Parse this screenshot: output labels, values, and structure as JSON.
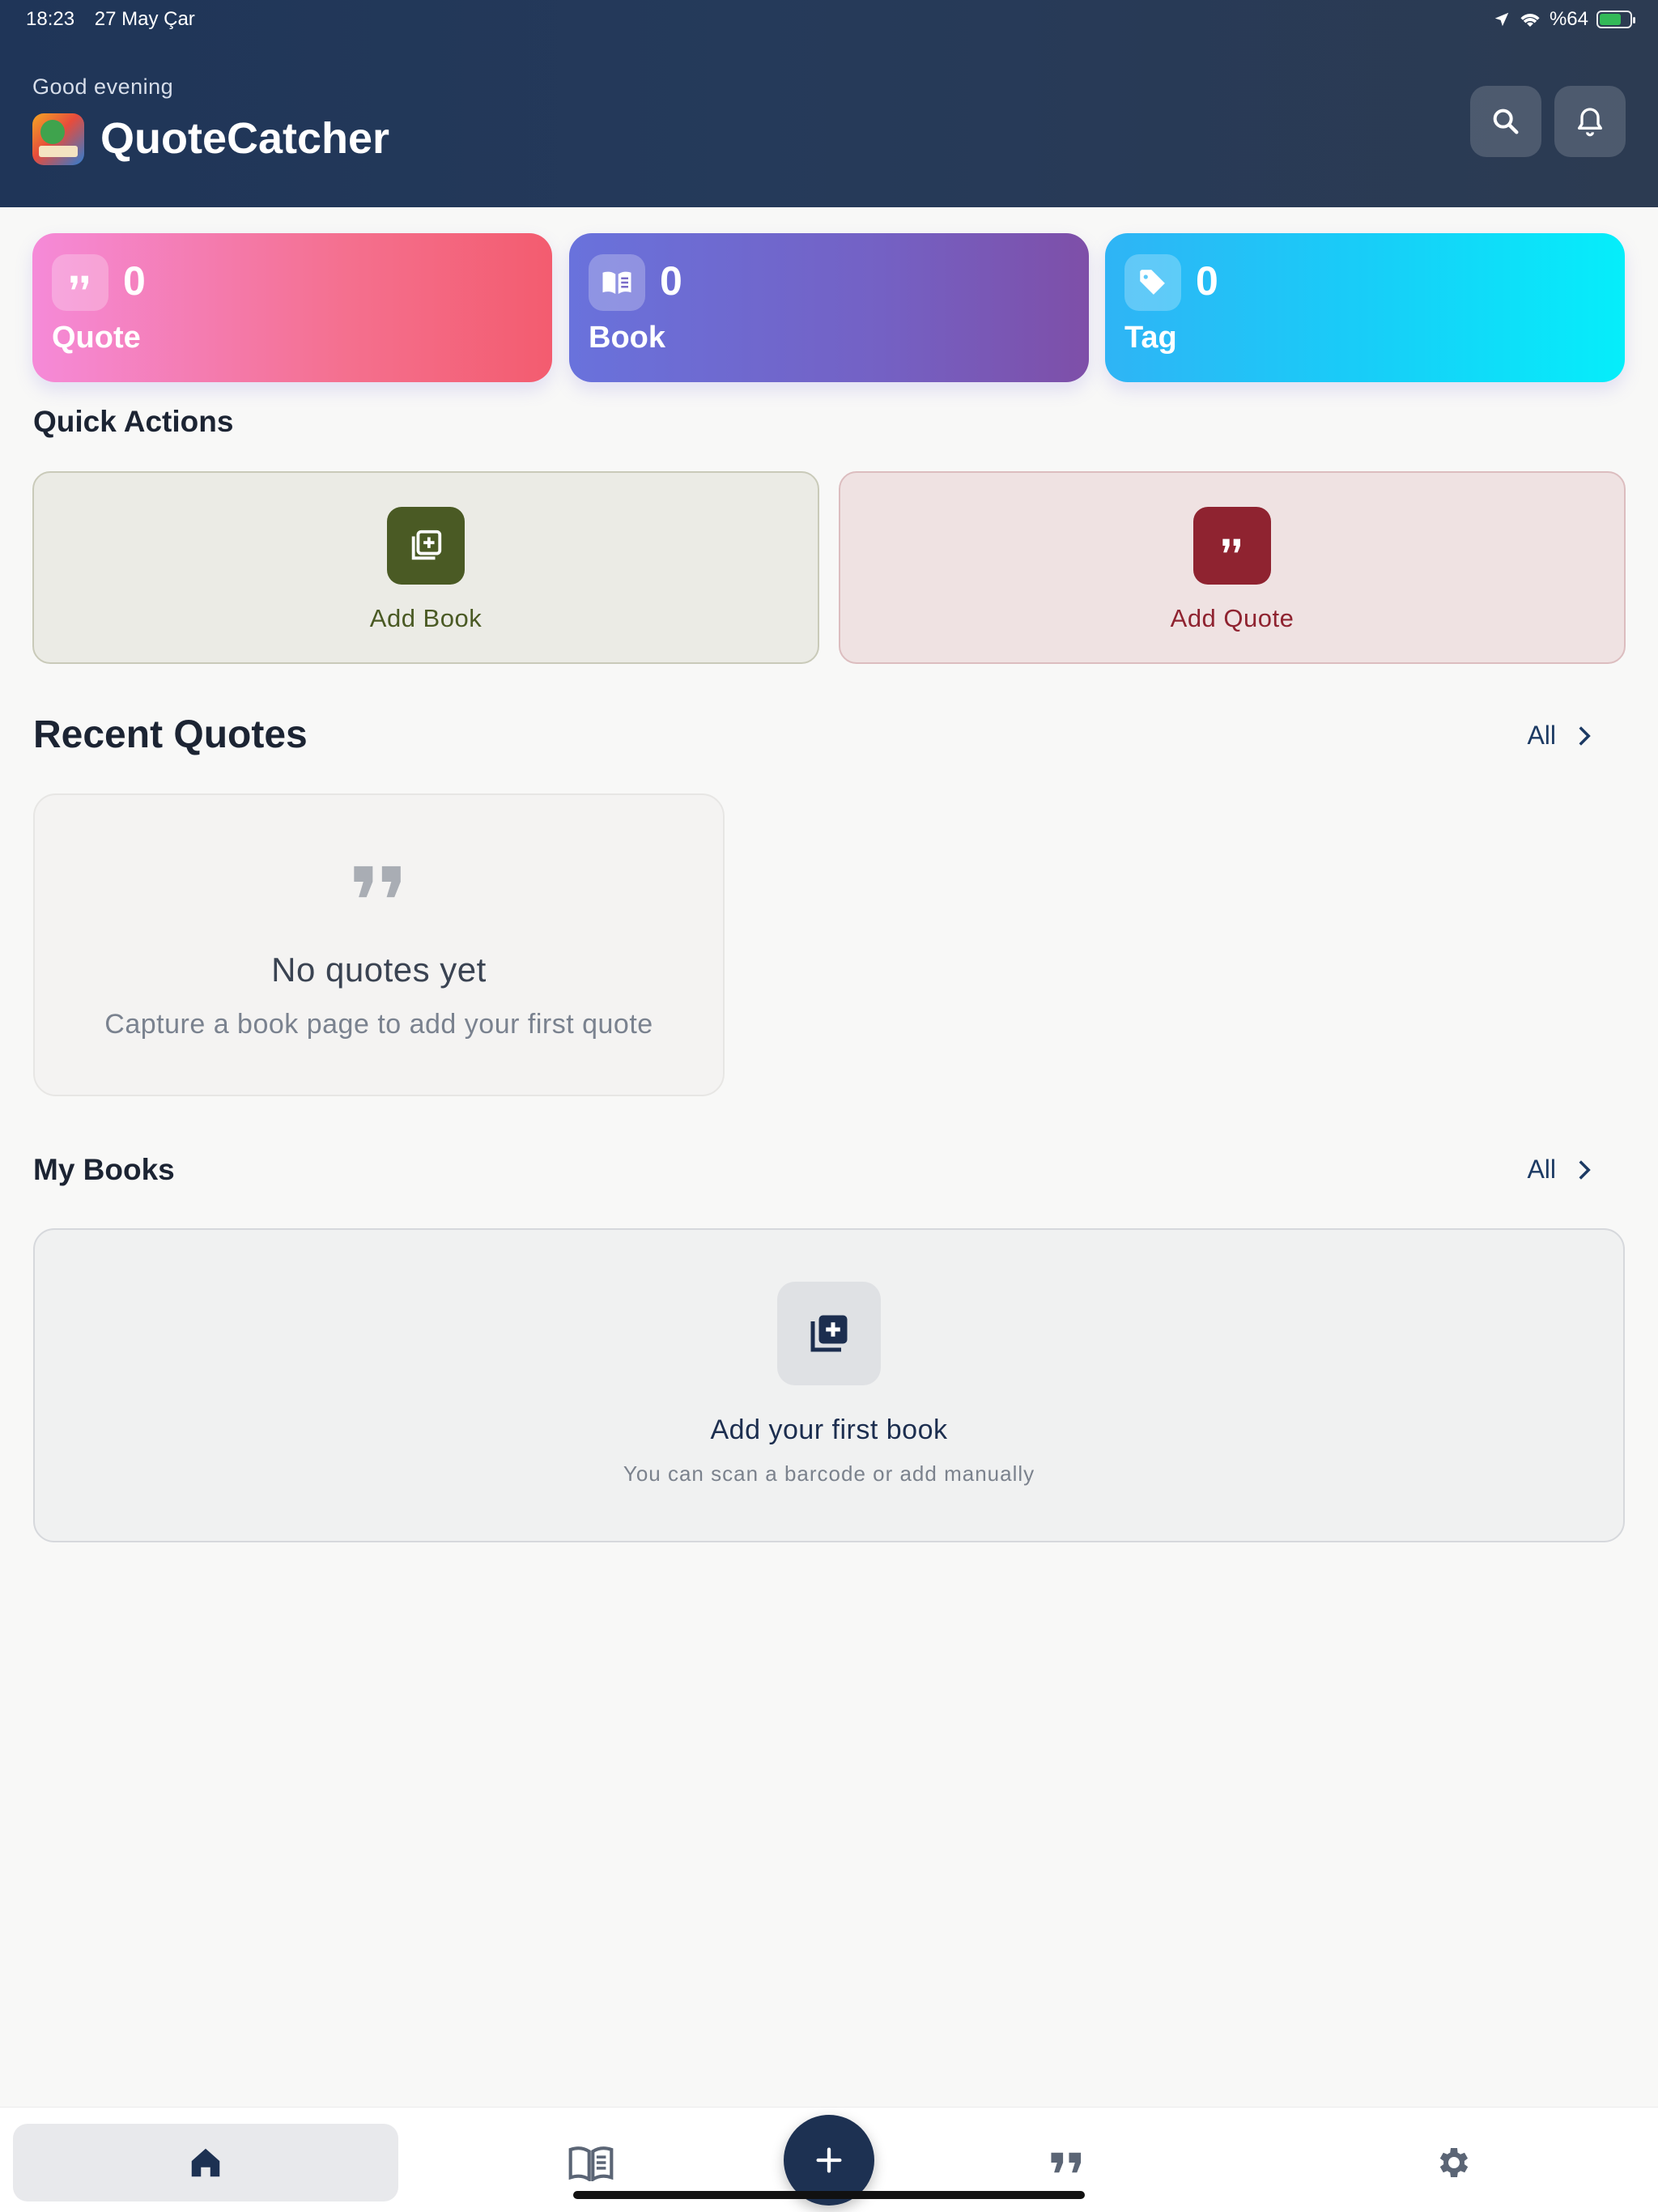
{
  "status_bar": {
    "time": "18:23",
    "date": "27 May Çar",
    "battery": "%64"
  },
  "header": {
    "greeting": "Good evening",
    "app_title": "QuoteCatcher"
  },
  "stats": [
    {
      "count": "0",
      "label": "Quote",
      "icon": "quote-icon"
    },
    {
      "count": "0",
      "label": "Book",
      "icon": "book-icon"
    },
    {
      "count": "0",
      "label": "Tag",
      "icon": "tag-icon"
    }
  ],
  "quick_actions": {
    "title": "Quick Actions",
    "add_book": "Add Book",
    "add_quote": "Add Quote"
  },
  "recent_quotes": {
    "title": "Recent Quotes",
    "all_link": "All",
    "empty_title": "No quotes yet",
    "empty_subtitle": "Capture a book page to add your first quote"
  },
  "my_books": {
    "title": "My Books",
    "all_link": "All",
    "empty_title": "Add your first book",
    "empty_subtitle": "You can scan a barcode or add manually"
  },
  "tabbar": [
    "home-icon",
    "book-icon",
    "add-icon",
    "quote-icon",
    "settings-icon"
  ],
  "colors": {
    "header": "#1f3558",
    "quote_card": "#f25f7a",
    "book_card": "#6a6fd8",
    "tag_card": "#12dcf5",
    "add_book": "#4a5a24",
    "add_quote": "#8f2330",
    "fab": "#1d3152"
  }
}
